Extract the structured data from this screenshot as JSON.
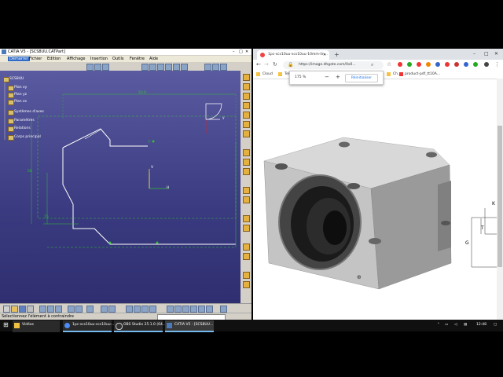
{
  "catia": {
    "title": "CATIA V5 - [SCS8UU.CATPart]",
    "menu": [
      "Démarrer",
      "Fichier",
      "Edition",
      "Affichage",
      "Insertion",
      "Outils",
      "Fenêtre",
      "Aide"
    ],
    "tree": [
      "SCS8UU",
      "Plan xy",
      "Plan yz",
      "Plan zx",
      "Systèmes d'axes",
      "Paramètres",
      "Relations",
      "Corps principal"
    ],
    "compass_axis_y": "y",
    "axis_h": "H",
    "axis_v": "V",
    "dims": {
      "top": "50.8",
      "left_tall": "58",
      "left_mid": "15",
      "left_small": "7"
    },
    "status_text": "Sélectionnez l'élément à contraindre"
  },
  "chrome": {
    "tab_title": "1pc-scs10uu-scs10uu-10mm-lin...",
    "url": "https://image.dhgate.com/0x0...",
    "zoom_value": "175 %",
    "zoom_minus": "−",
    "zoom_plus": "+",
    "reset_label": "Réinitialiser",
    "bookmarks": [
      "Cloud",
      "Tel",
      "Ch...",
      "product-pdf_tt10A..."
    ],
    "dims": {
      "k": "K",
      "g": "G",
      "t": "T"
    }
  },
  "taskbar": {
    "tasks": [
      "Vidéos",
      "1pc-scs10uu-scs10uu-...",
      "OBS Studio 25.1.0 (64...",
      "CATIA V5 - [SCS8UU..."
    ],
    "time": "12:48",
    "colors": {
      "accent": "#76b9ed"
    }
  }
}
